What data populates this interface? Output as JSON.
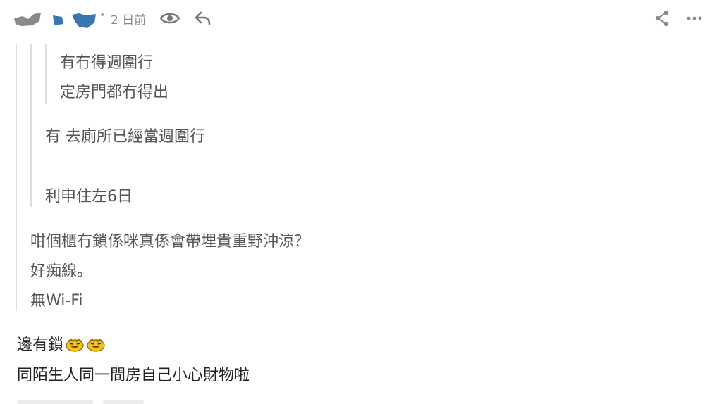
{
  "header": {
    "time_label": "2 日前",
    "icons": [
      "eye-icon",
      "reply-icon",
      "share-icon",
      "more-icon"
    ]
  },
  "quote_level3": {
    "lines": [
      "有冇得週圍行",
      "定房門都冇得出"
    ]
  },
  "quote_level2": {
    "lines": [
      "有 去廁所已經當週圍行",
      "利申住左6日"
    ]
  },
  "quote_level1": {
    "lines": [
      "咁個櫃冇鎖係咪真係會帶埋貴重野沖涼？",
      "好痴線。",
      "無Wi-Fi"
    ]
  },
  "reply": {
    "line1": "邊有鎖",
    "line2": "同陌生人同一間房自己小心財物啦"
  },
  "colors": {
    "accent_blue": "#3a77b0",
    "avatar_gray": "#8a8a8a",
    "quote_bar": "#dedede",
    "emoji_yellow": "#f0c419"
  }
}
